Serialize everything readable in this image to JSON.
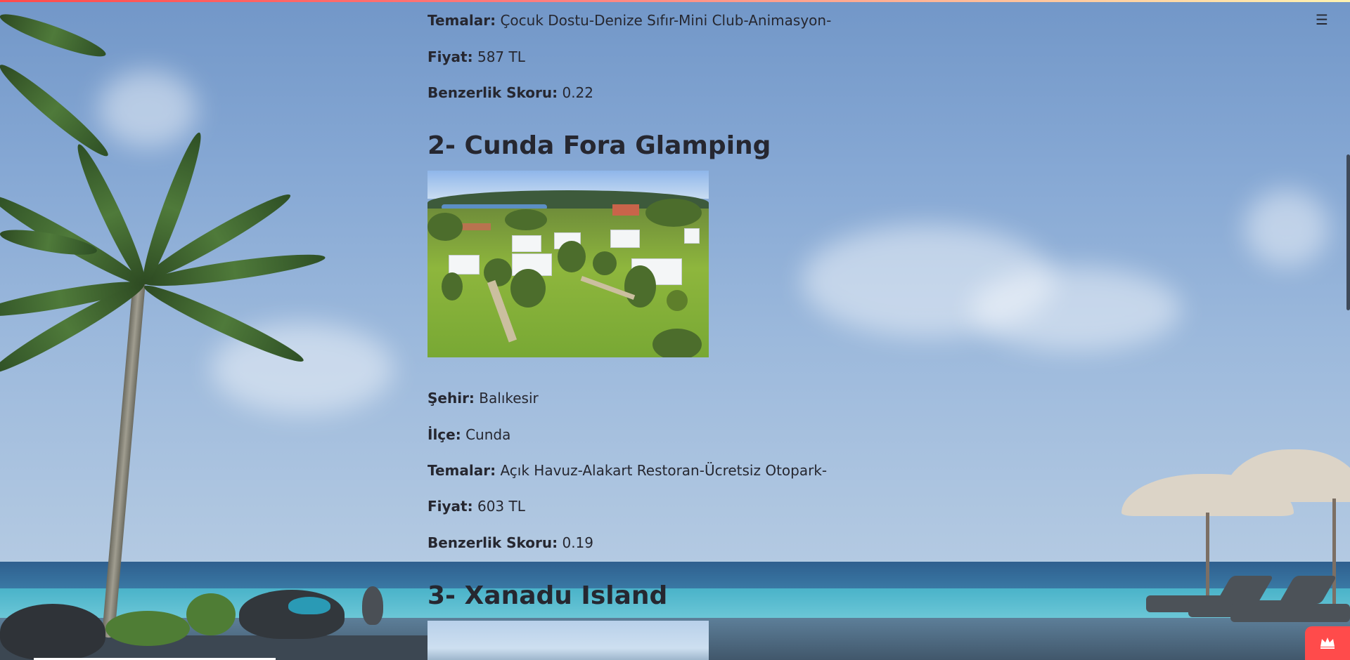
{
  "app": {
    "menu_icon": "hamburger-menu-icon",
    "badge_icon": "crown-icon",
    "accent_color": "#ff4b4b"
  },
  "results": [
    {
      "themes_label": "Temalar:",
      "themes": "Çocuk Dostu-Denize Sıfır-Mini Club-Animasyon-",
      "price_label": "Fiyat:",
      "price": "587 TL",
      "score_label": "Benzerlik Skoru:",
      "score": "0.22"
    },
    {
      "title": "2- Cunda Fora Glamping",
      "city_label": "Şehir:",
      "city": "Balıkesir",
      "district_label": "İlçe:",
      "district": "Cunda",
      "themes_label": "Temalar:",
      "themes": "Açık Havuz-Alakart Restoran-Ücretsiz Otopark-",
      "price_label": "Fiyat:",
      "price": "603 TL",
      "score_label": "Benzerlik Skoru:",
      "score": "0.19"
    },
    {
      "title": "3- Xanadu Island"
    }
  ]
}
